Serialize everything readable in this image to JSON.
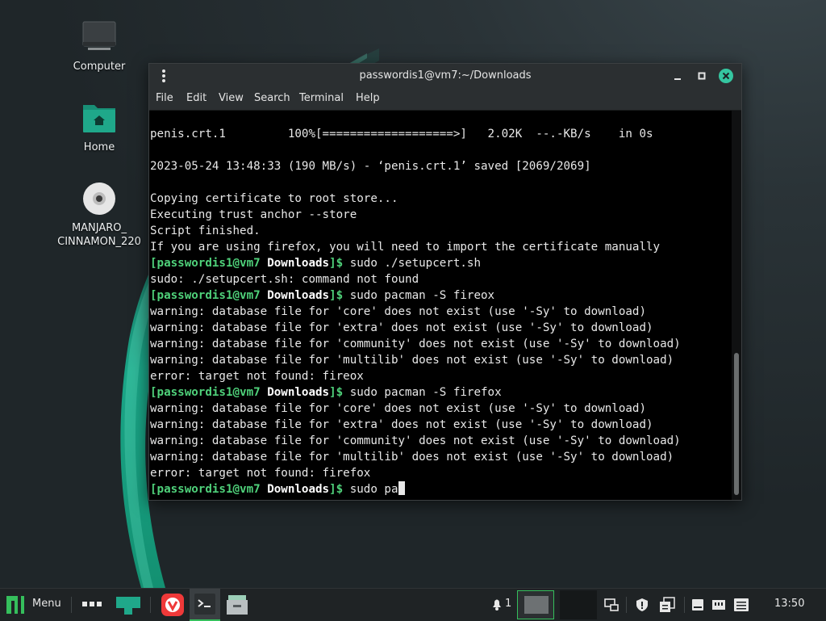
{
  "desktop": {
    "icons": [
      {
        "label": "Computer"
      },
      {
        "label": "Home"
      },
      {
        "label": "MANJARO_\nCINNAMON_220"
      }
    ]
  },
  "window": {
    "title": "passwordis1@vm7:~/Downloads",
    "menu": [
      "File",
      "Edit",
      "View",
      "Search",
      "Terminal",
      "Help"
    ]
  },
  "terminal": {
    "prompt_user": "[passwordis1@vm7",
    "prompt_dir": "Downloads",
    "prompt_end": "]$",
    "lines": [
      {
        "type": "out",
        "text": "penis.crt.1         100%[===================>]   2.02K  --.-KB/s    in 0s"
      },
      {
        "type": "out",
        "text": ""
      },
      {
        "type": "out",
        "text": "2023-05-24 13:48:33 (190 MB/s) - ‘penis.crt.1’ saved [2069/2069]"
      },
      {
        "type": "out",
        "text": ""
      },
      {
        "type": "out",
        "text": "Copying certificate to root store..."
      },
      {
        "type": "out",
        "text": "Executing trust anchor --store"
      },
      {
        "type": "out",
        "text": "Script finished."
      },
      {
        "type": "out",
        "text": "If you are using firefox, you will need to import the certificate manually"
      },
      {
        "type": "prompt",
        "text": " sudo ./setupcert.sh"
      },
      {
        "type": "out",
        "text": "sudo: ./setupcert.sh: command not found"
      },
      {
        "type": "prompt",
        "text": " sudo pacman -S fireox"
      },
      {
        "type": "out",
        "text": "warning: database file for 'core' does not exist (use '-Sy' to download)"
      },
      {
        "type": "out",
        "text": "warning: database file for 'extra' does not exist (use '-Sy' to download)"
      },
      {
        "type": "out",
        "text": "warning: database file for 'community' does not exist (use '-Sy' to download)"
      },
      {
        "type": "out",
        "text": "warning: database file for 'multilib' does not exist (use '-Sy' to download)"
      },
      {
        "type": "out",
        "text": "error: target not found: fireox"
      },
      {
        "type": "prompt",
        "text": " sudo pacman -S firefox"
      },
      {
        "type": "out",
        "text": "warning: database file for 'core' does not exist (use '-Sy' to download)"
      },
      {
        "type": "out",
        "text": "warning: database file for 'extra' does not exist (use '-Sy' to download)"
      },
      {
        "type": "out",
        "text": "warning: database file for 'community' does not exist (use '-Sy' to download)"
      },
      {
        "type": "out",
        "text": "warning: database file for 'multilib' does not exist (use '-Sy' to download)"
      },
      {
        "type": "out",
        "text": "error: target not found: firefox"
      },
      {
        "type": "prompt",
        "text": " sudo pa",
        "cursor": true
      }
    ]
  },
  "taskbar": {
    "menu_label": "Menu",
    "notification_count": "1",
    "clock": "13:50"
  },
  "colors": {
    "accent": "#35bf5c",
    "prompt": "#4fd17a",
    "folder": "#1fa88a"
  }
}
